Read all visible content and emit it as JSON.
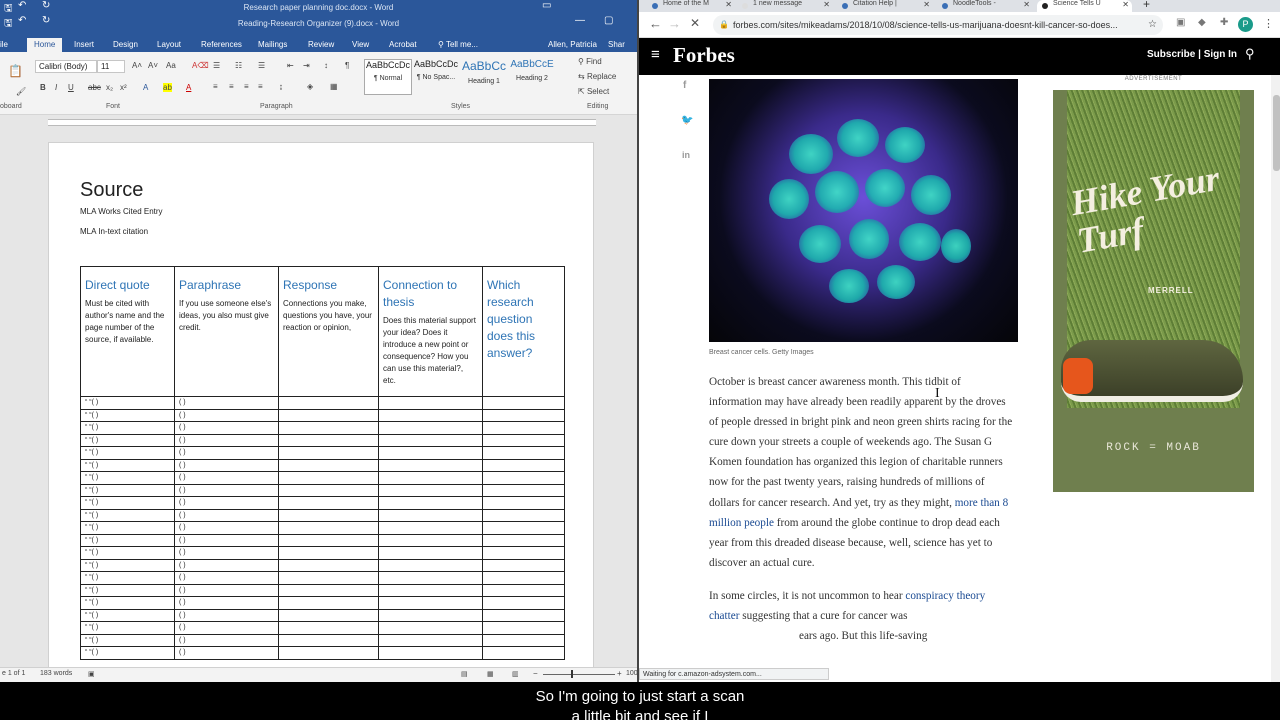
{
  "word": {
    "doc_title": "Reading-Research Organizer (9).docx - Word",
    "other_title": "Research paper planning doc.docx - Word",
    "tabs": [
      "ile",
      "Home",
      "Insert",
      "Design",
      "Layout",
      "References",
      "Mailings",
      "Review",
      "View",
      "Acrobat",
      "Tell me..."
    ],
    "user": "Allen, Patricia",
    "share": "Shar",
    "font_name": "Calibri (Body)",
    "font_size": "11",
    "styles": [
      {
        "sample": "AaBbCcDc",
        "name": "¶ Normal"
      },
      {
        "sample": "AaBbCcDc",
        "name": "¶ No Spac..."
      },
      {
        "sample": "AaBbCc",
        "name": "Heading 1"
      },
      {
        "sample": "AaBbCcE",
        "name": "Heading 2"
      }
    ],
    "editing": [
      "Find",
      "Replace",
      "Select"
    ],
    "groups": [
      "oboard",
      "Font",
      "Paragraph",
      "Styles",
      "Editing"
    ],
    "page": {
      "heading": "Source",
      "line1": "MLA Works Cited Entry",
      "line2": "MLA In-text citation",
      "columns": [
        {
          "title": "Direct quote",
          "desc": "Must be cited with author's name and the page number of the source, if available."
        },
        {
          "title": "Paraphrase",
          "desc": "If you use someone else's ideas, you also must give credit."
        },
        {
          "title": "Response",
          "desc": "Connections you make, questions you have, your reaction or opinion,"
        },
        {
          "title": "Connection to thesis",
          "desc": "Does this material support your idea? Does it introduce a new point or consequence? How you can use this material?, etc."
        },
        {
          "title": "Which research question does this answer?",
          "desc": ""
        }
      ],
      "quote_cell": "“ “( )",
      "para_cell": "( )"
    },
    "status": {
      "page": "e 1 of 1",
      "words": "183 words",
      "zoom": "100"
    }
  },
  "browser": {
    "tabs": [
      "Home of the M",
      "1 new message",
      "Citation Help |",
      "NoodleTools -",
      "Science Tells U"
    ],
    "url": "forbes.com/sites/mikeadams/2018/10/08/science-tells-us-marijuana-doesnt-kill-cancer-so-does...",
    "avatar": "P",
    "status": "Waiting for c.amazon-adsystem.com..."
  },
  "forbes": {
    "logo": "Forbes",
    "subscribe": "Subscribe | Sign In",
    "caption": "Breast cancer cells. Getty Images",
    "ad_label": "ADVERTISEMENT",
    "ad_title": "Hike Your Turf",
    "ad_brand": "MERRELL",
    "ad_tag": "ROCK = MOAB",
    "p1_a": "October is breast cancer awareness month. This tidbit of information may have already been readily apparent by the droves of people dressed in bright pink and neon green shirts racing for the cure down your streets a couple of weekends ago. The Susan G Komen foundation has organized this legion of charitable runners now for the past twenty years, raising hundreds of millions of dollars for cancer research. And yet, try as they might,",
    "p1_link": "more than 8 million people",
    "p1_b": "from around the globe continue to drop dead each year from this dreaded disease because, well, science has yet to discover an actual cure.",
    "p2_a": "In some circles, it is not uncommon to hear",
    "p2_link": "conspiracy theory chatter",
    "p2_b": "suggesting that a cure for cancer was",
    "p2_c": "ears ago. But this life-saving"
  },
  "caption": {
    "line1": "So I'm going to just start a scan",
    "line2": "a little bit and see if I"
  }
}
